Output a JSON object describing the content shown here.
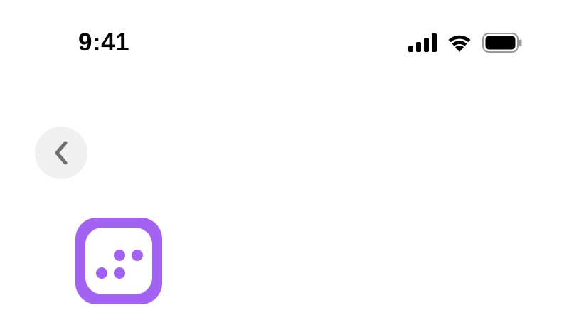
{
  "status_bar": {
    "time": "9:41",
    "icons": [
      "signal-icon",
      "wifi-icon",
      "battery-icon"
    ]
  },
  "navigation": {
    "back_icon": "chevron-left-icon"
  },
  "app_icon": {
    "icon": "app-logo-dots-icon",
    "color": "#a363f2"
  },
  "colors": {
    "background": "#ffffff",
    "back_button_bg": "#f0f0f0",
    "back_chevron": "#6e6e73",
    "accent": "#a363f2"
  }
}
